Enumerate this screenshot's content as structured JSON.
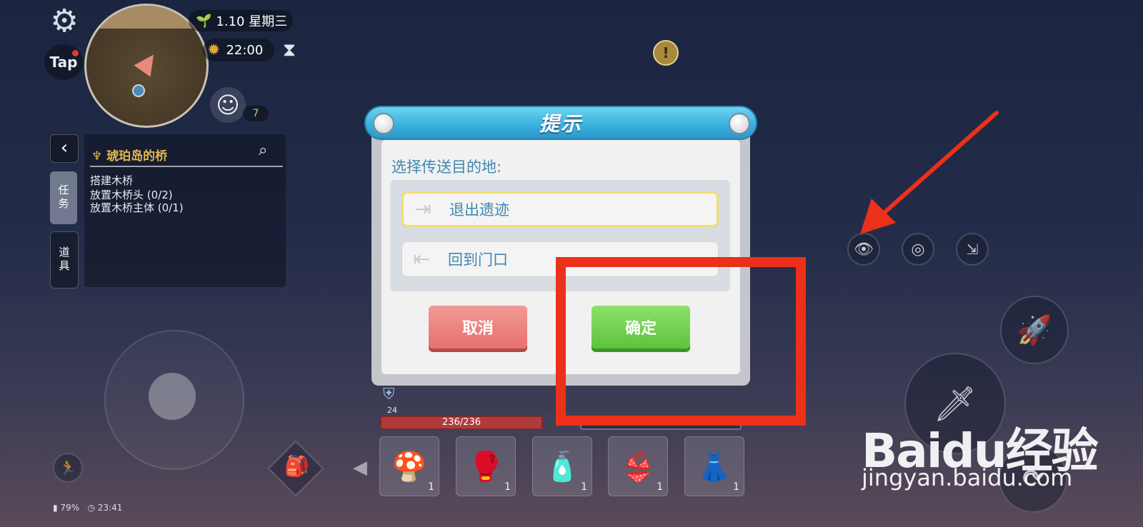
{
  "hud": {
    "date": "1.10 星期三",
    "time": "22:00",
    "tap_label": "Tap",
    "npc_count": "7",
    "alert_symbol": "!"
  },
  "quest": {
    "title": "琥珀岛的桥",
    "tab_task": "任务",
    "tab_item": "道具",
    "lines": [
      "搭建木桥",
      "放置木桥头 (0/2)",
      "放置木桥主体 (0/1)"
    ]
  },
  "status": {
    "battery": "79%",
    "clock": "23:41"
  },
  "player": {
    "level": "24",
    "hp": "236/236"
  },
  "hotbar": [
    {
      "name": "mushroom",
      "icon": "🍄",
      "count": "1"
    },
    {
      "name": "boxing-glove",
      "icon": "🥊",
      "count": "1"
    },
    {
      "name": "canteen",
      "icon": "🧴",
      "count": "1"
    },
    {
      "name": "bikini-top",
      "icon": "👙",
      "count": "1"
    },
    {
      "name": "frilly-skirt",
      "icon": "👗",
      "count": "1"
    }
  ],
  "dialog": {
    "title": "提示",
    "prompt": "选择传送目的地:",
    "options": [
      "退出遗迹",
      "回到门口"
    ],
    "cancel": "取消",
    "confirm": "确定"
  },
  "watermark": {
    "brand": "Baidu经验",
    "url": "jingyan.baidu.com"
  },
  "colors": {
    "annotation_red": "#ec3019",
    "dialog_header": "#3ab2df",
    "confirm_green": "#5cc43e",
    "cancel_red": "#e7706d"
  }
}
